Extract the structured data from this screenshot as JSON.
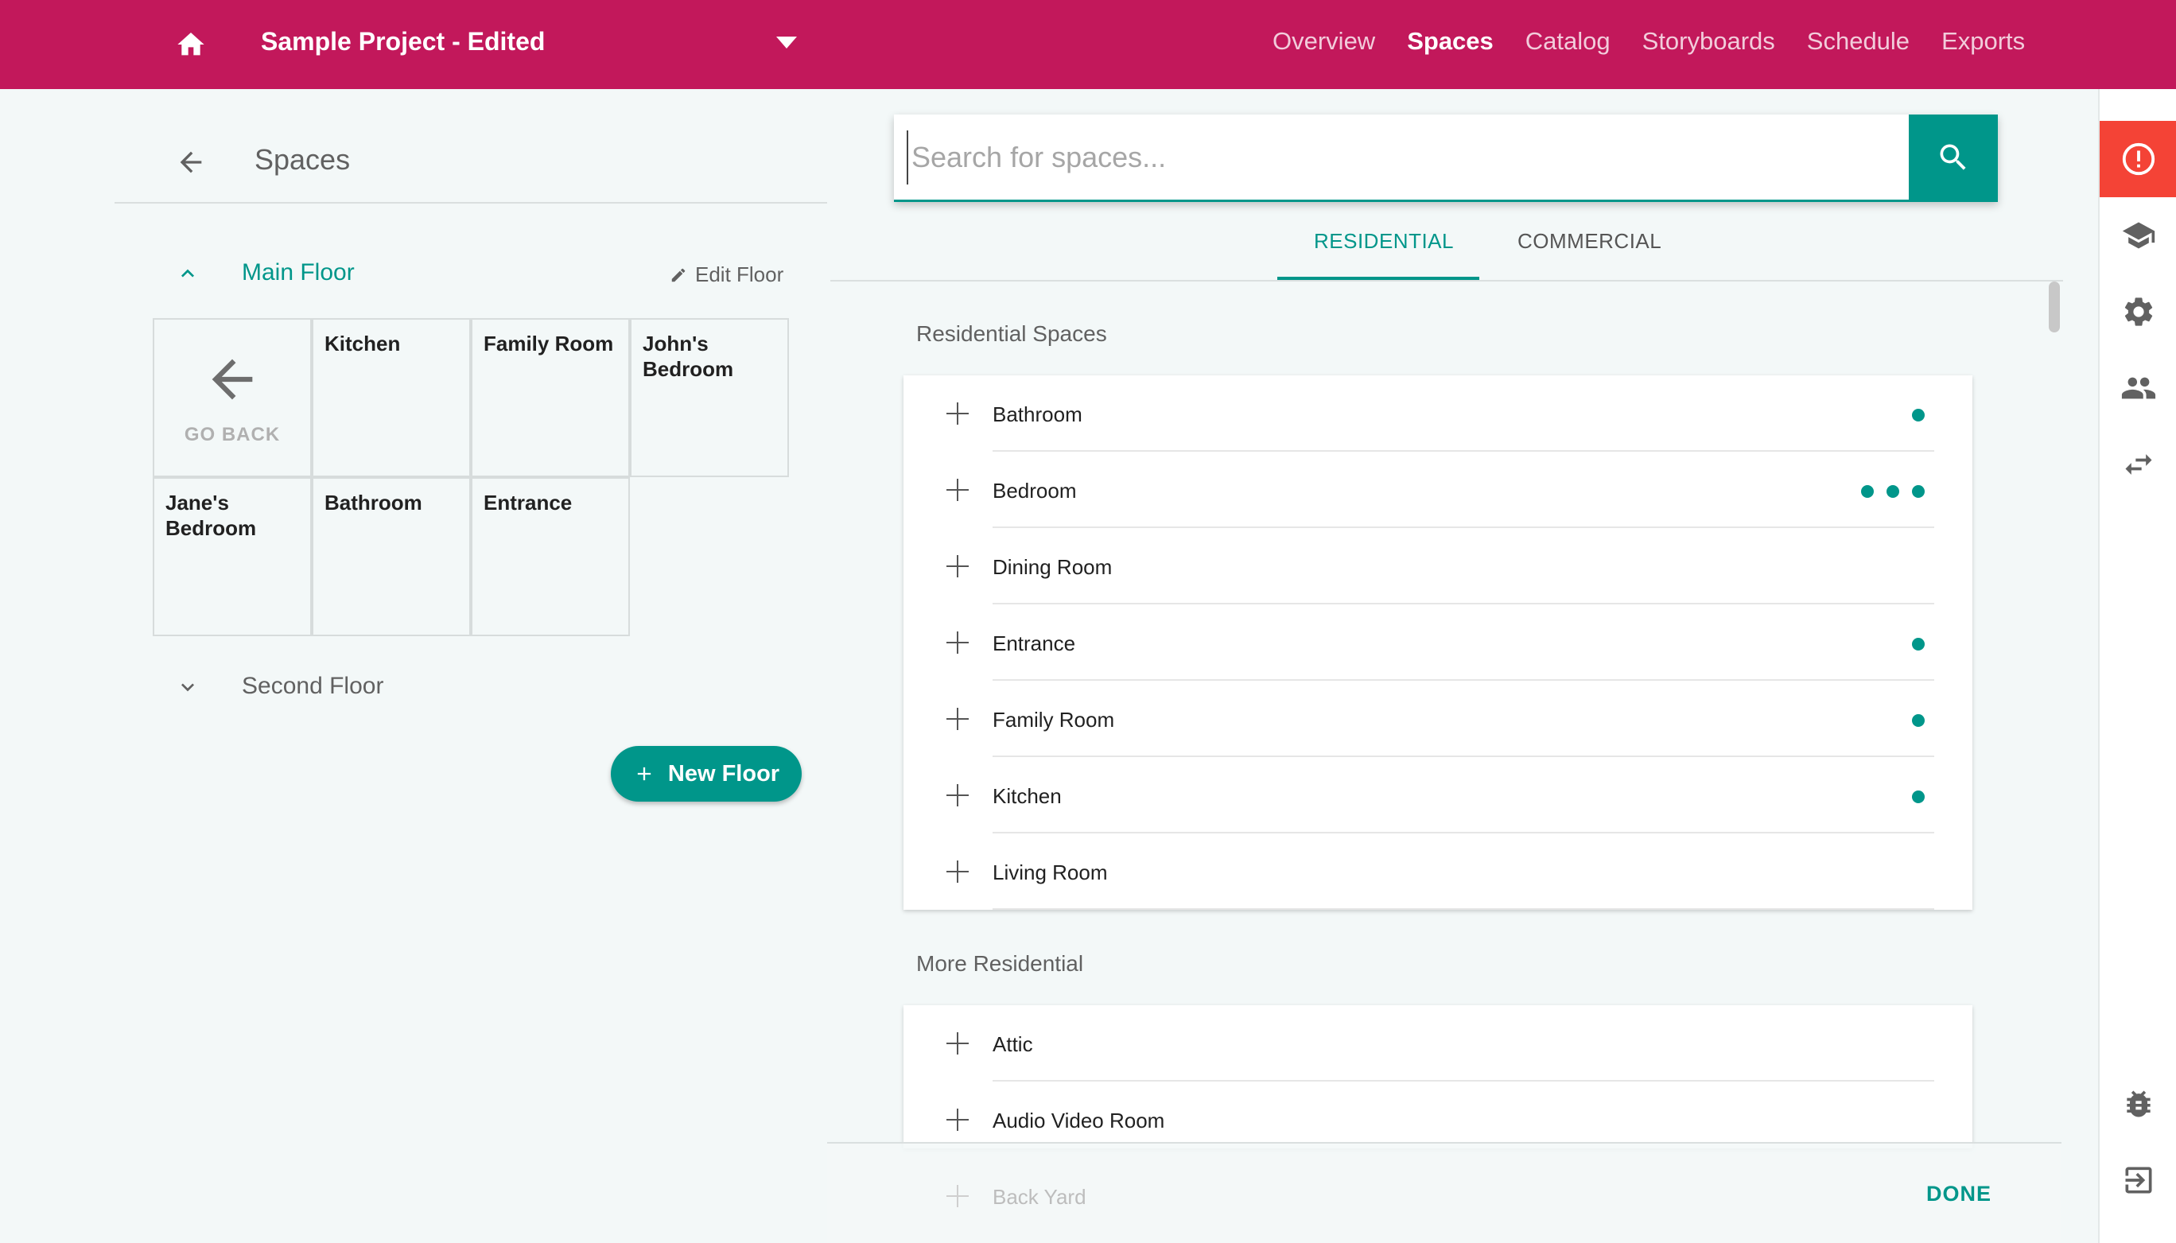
{
  "header": {
    "project_title": "Sample Project - Edited",
    "nav": [
      {
        "label": "Overview"
      },
      {
        "label": "Spaces"
      },
      {
        "label": "Catalog"
      },
      {
        "label": "Storyboards"
      },
      {
        "label": "Schedule"
      },
      {
        "label": "Exports"
      }
    ],
    "active_nav": "Spaces",
    "bar_color": "#c2185b"
  },
  "left_panel": {
    "title": "Spaces",
    "main_floor": {
      "name": "Main Floor",
      "edit_label": "Edit Floor",
      "go_back_label": "GO BACK",
      "rooms": [
        "Kitchen",
        "Family Room",
        "John's Bedroom",
        "Jane's Bedroom",
        "Bathroom",
        "Entrance"
      ]
    },
    "second_floor": {
      "name": "Second Floor"
    },
    "new_floor_label": "New Floor"
  },
  "search": {
    "placeholder": "Search for spaces...",
    "value": ""
  },
  "tabs": [
    {
      "label": "RESIDENTIAL",
      "active": true
    },
    {
      "label": "COMMERCIAL",
      "active": false
    }
  ],
  "residential_spaces": {
    "title": "Residential Spaces",
    "items": [
      {
        "label": "Bathroom",
        "dots": 1
      },
      {
        "label": "Bedroom",
        "dots": 3
      },
      {
        "label": "Dining Room",
        "dots": 0
      },
      {
        "label": "Entrance",
        "dots": 1
      },
      {
        "label": "Family Room",
        "dots": 1
      },
      {
        "label": "Kitchen",
        "dots": 1
      },
      {
        "label": "Living Room",
        "dots": 0
      }
    ]
  },
  "more_residential": {
    "title": "More Residential",
    "items": [
      {
        "label": "Attic"
      },
      {
        "label": "Audio Video Room"
      },
      {
        "label": "Back Yard"
      }
    ]
  },
  "footer": {
    "done_label": "DONE"
  },
  "accent_color": "#00968a",
  "alert_color": "#f44336",
  "rail_icons": [
    "alert-icon",
    "graduation-cap-icon",
    "gear-icon",
    "people-icon",
    "swap-icon",
    "bug-icon",
    "exit-icon"
  ]
}
